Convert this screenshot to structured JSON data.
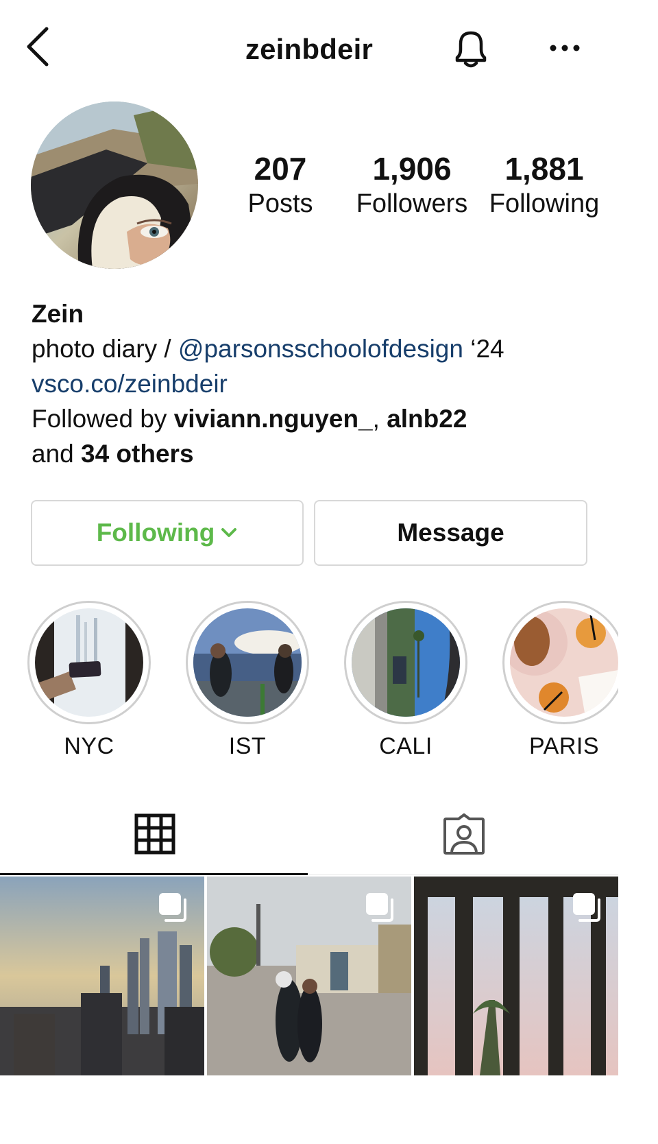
{
  "header": {
    "username": "zeinbdeir",
    "back_icon": "chevron-left-icon",
    "bell_icon": "bell-icon",
    "more_icon": "more-horizontal-icon"
  },
  "stats": {
    "posts": {
      "count": "207",
      "label": "Posts"
    },
    "followers": {
      "count": "1,906",
      "label": "Followers"
    },
    "following": {
      "count": "1,881",
      "label": "Following"
    }
  },
  "bio": {
    "name": "Zein",
    "line1_text": "photo diary / ",
    "line1_mention": "@parsonsschoolofdesign",
    "line1_suffix": " ‘24",
    "link": "vsco.co/zeinbdeir",
    "followed_by_prefix": "Followed by ",
    "followed_by_names": "viviann.nguyen_",
    "followed_by_sep": ", ",
    "followed_by_names2": "alnb22",
    "followed_by_and": "and ",
    "followed_by_others": "34 others"
  },
  "buttons": {
    "following_label": "Following",
    "message_label": "Message"
  },
  "highlights": [
    {
      "label": "NYC"
    },
    {
      "label": "IST"
    },
    {
      "label": "CALI"
    },
    {
      "label": "PARIS"
    }
  ],
  "tabs": {
    "active": "grid",
    "grid_icon": "grid-icon",
    "tagged_icon": "tagged-person-icon"
  },
  "colors": {
    "following_green": "#5db94a",
    "link_blue": "#173e6b",
    "border_gray": "#d8d8d8"
  }
}
